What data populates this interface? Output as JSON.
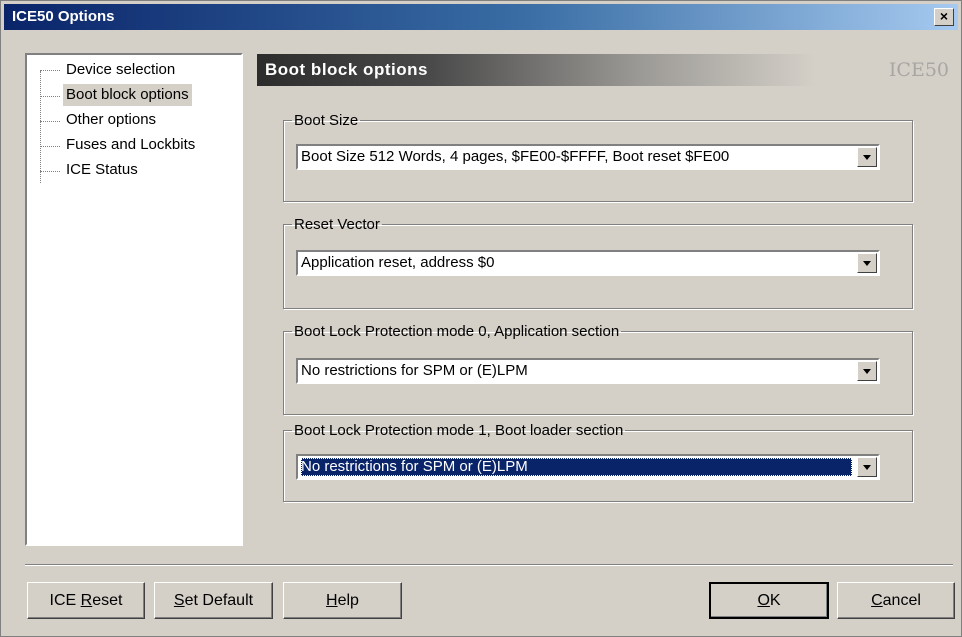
{
  "window": {
    "title": "ICE50 Options",
    "close_label": "×"
  },
  "tree": {
    "items": [
      {
        "label": "Device selection"
      },
      {
        "label": "Boot block options"
      },
      {
        "label": "Other options"
      },
      {
        "label": "Fuses and Lockbits"
      },
      {
        "label": "ICE Status"
      }
    ],
    "selected": "Boot block options"
  },
  "panel": {
    "title": "Boot block options",
    "brand": "ICE50"
  },
  "groups": {
    "boot_size": {
      "legend": "Boot Size",
      "value": "Boot Size 512 Words, 4 pages, $FE00-$FFFF, Boot reset $FE00"
    },
    "reset_vector": {
      "legend": "Reset Vector",
      "value": "Application reset, address $0"
    },
    "lock_mode0": {
      "legend": "Boot Lock Protection mode 0, Application section",
      "value": "No restrictions for SPM or (E)LPM"
    },
    "lock_mode1": {
      "legend": "Boot Lock Protection mode 1, Boot loader section",
      "value": "No restrictions for SPM or (E)LPM"
    }
  },
  "buttons": {
    "ice_reset": {
      "pre": "ICE ",
      "mn": "R",
      "post": "eset"
    },
    "set_default": {
      "pre": "",
      "mn": "S",
      "post": "et Default"
    },
    "help": {
      "pre": "",
      "mn": "H",
      "post": "elp"
    },
    "ok": {
      "pre": "",
      "mn": "O",
      "post": "K"
    },
    "cancel": {
      "pre": "",
      "mn": "C",
      "post": "ancel"
    }
  }
}
